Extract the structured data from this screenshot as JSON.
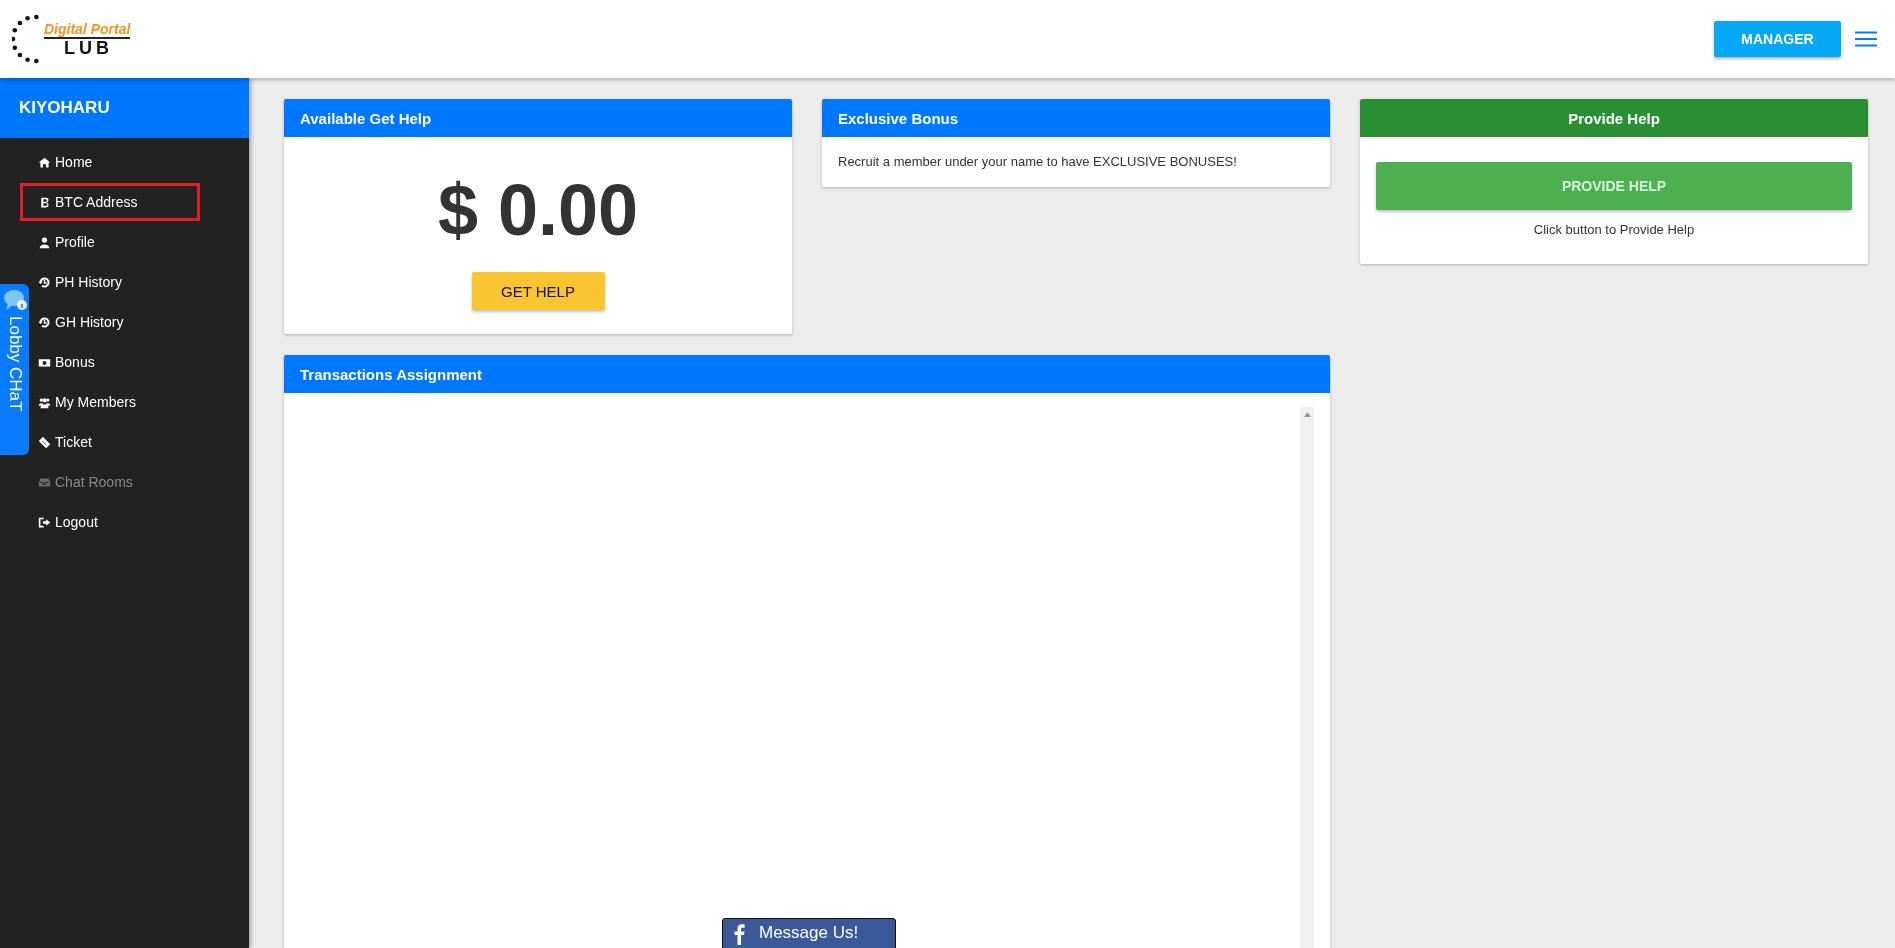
{
  "header": {
    "logo": {
      "top_text": "Digital Portal",
      "bottom_text": "LUB"
    },
    "manager_button": "MANAGER"
  },
  "sidebar": {
    "username": "KIYOHARU",
    "items": [
      {
        "label": "Home",
        "highlighted": false,
        "disabled": false
      },
      {
        "label": "BTC Address",
        "highlighted": true,
        "disabled": false
      },
      {
        "label": "Profile",
        "highlighted": false,
        "disabled": false
      },
      {
        "label": "PH History",
        "highlighted": false,
        "disabled": false
      },
      {
        "label": "GH History",
        "highlighted": false,
        "disabled": false
      },
      {
        "label": "Bonus",
        "highlighted": false,
        "disabled": false
      },
      {
        "label": "My Members",
        "highlighted": false,
        "disabled": false
      },
      {
        "label": "Ticket",
        "highlighted": false,
        "disabled": false
      },
      {
        "label": "Chat Rooms",
        "highlighted": false,
        "disabled": true
      },
      {
        "label": "Logout",
        "highlighted": false,
        "disabled": false
      }
    ]
  },
  "lobby_chat": {
    "label": "Lobby CHaT"
  },
  "available_get_help": {
    "title": "Available Get Help",
    "amount": "$ 0.00",
    "button": "GET HELP"
  },
  "exclusive_bonus": {
    "title": "Exclusive Bonus",
    "text": "Recruit a member under your name to have EXCLUSIVE BONUSES!"
  },
  "provide_help": {
    "title": "Provide Help",
    "button": "PROVIDE HELP",
    "button_disabled": true,
    "hint": "Click button to Provide Help"
  },
  "transactions": {
    "title": "Transactions Assignment"
  },
  "messenger_button": "Message Us!"
}
